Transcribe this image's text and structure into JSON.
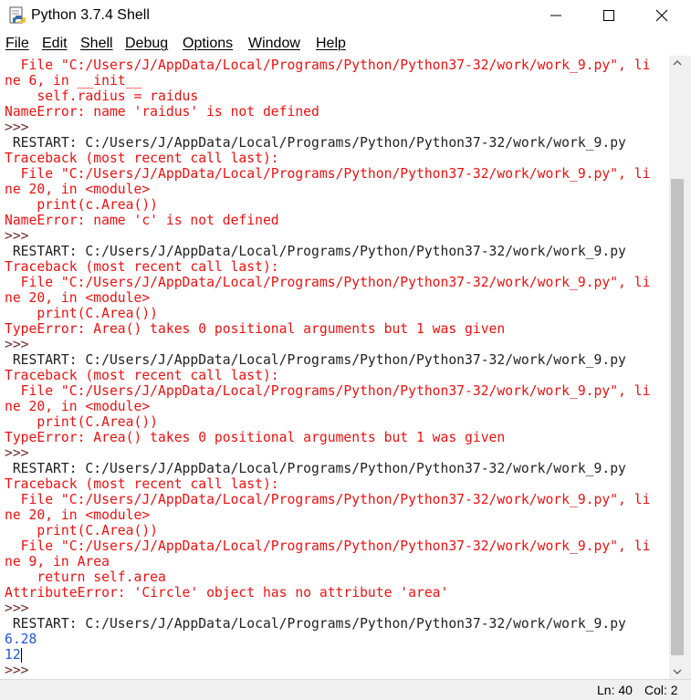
{
  "window": {
    "title": "Python 3.7.4 Shell",
    "icon": "python-idle-icon",
    "controls": {
      "minimize_icon": "minimize-icon",
      "maximize_icon": "maximize-icon",
      "close_icon": "close-icon"
    }
  },
  "menu": {
    "items": [
      "File",
      "Edit",
      "Shell",
      "Debug",
      "Options",
      "Window",
      "Help"
    ]
  },
  "shell": {
    "lines": [
      {
        "text": "  File \"C:/Users/J/AppData/Local/Programs/Python/Python37-32/work/work_9.py\", li",
        "style": "red"
      },
      {
        "text": "ne 6, in __init__",
        "style": "red"
      },
      {
        "text": "    self.radius = raidus",
        "style": "red"
      },
      {
        "text": "NameError: name 'raidus' is not defined",
        "style": "red"
      },
      {
        "text": ">>>",
        "style": "brown"
      },
      {
        "text": " RESTART: C:/Users/J/AppData/Local/Programs/Python/Python37-32/work/work_9.py",
        "style": "dark"
      },
      {
        "text": "Traceback (most recent call last):",
        "style": "red"
      },
      {
        "text": "  File \"C:/Users/J/AppData/Local/Programs/Python/Python37-32/work/work_9.py\", li",
        "style": "red"
      },
      {
        "text": "ne 20, in <module>",
        "style": "red"
      },
      {
        "text": "    print(c.Area())",
        "style": "red"
      },
      {
        "text": "NameError: name 'c' is not defined",
        "style": "red"
      },
      {
        "text": ">>>",
        "style": "brown"
      },
      {
        "text": " RESTART: C:/Users/J/AppData/Local/Programs/Python/Python37-32/work/work_9.py",
        "style": "dark"
      },
      {
        "text": "Traceback (most recent call last):",
        "style": "red"
      },
      {
        "text": "  File \"C:/Users/J/AppData/Local/Programs/Python/Python37-32/work/work_9.py\", li",
        "style": "red"
      },
      {
        "text": "ne 20, in <module>",
        "style": "red"
      },
      {
        "text": "    print(C.Area())",
        "style": "red"
      },
      {
        "text": "TypeError: Area() takes 0 positional arguments but 1 was given",
        "style": "red"
      },
      {
        "text": ">>>",
        "style": "brown"
      },
      {
        "text": " RESTART: C:/Users/J/AppData/Local/Programs/Python/Python37-32/work/work_9.py",
        "style": "dark"
      },
      {
        "text": "Traceback (most recent call last):",
        "style": "red"
      },
      {
        "text": "  File \"C:/Users/J/AppData/Local/Programs/Python/Python37-32/work/work_9.py\", li",
        "style": "red"
      },
      {
        "text": "ne 20, in <module>",
        "style": "red"
      },
      {
        "text": "    print(C.Area())",
        "style": "red"
      },
      {
        "text": "TypeError: Area() takes 0 positional arguments but 1 was given",
        "style": "red"
      },
      {
        "text": ">>>",
        "style": "brown"
      },
      {
        "text": " RESTART: C:/Users/J/AppData/Local/Programs/Python/Python37-32/work/work_9.py",
        "style": "dark"
      },
      {
        "text": "Traceback (most recent call last):",
        "style": "red"
      },
      {
        "text": "  File \"C:/Users/J/AppData/Local/Programs/Python/Python37-32/work/work_9.py\", li",
        "style": "red"
      },
      {
        "text": "ne 20, in <module>",
        "style": "red"
      },
      {
        "text": "    print(C.Area())",
        "style": "red"
      },
      {
        "text": "  File \"C:/Users/J/AppData/Local/Programs/Python/Python37-32/work/work_9.py\", li",
        "style": "red"
      },
      {
        "text": "ne 9, in Area",
        "style": "red"
      },
      {
        "text": "    return self.area",
        "style": "red"
      },
      {
        "text": "AttributeError: 'Circle' object has no attribute 'area'",
        "style": "red"
      },
      {
        "text": ">>>",
        "style": "brown"
      },
      {
        "text": " RESTART: C:/Users/J/AppData/Local/Programs/Python/Python37-32/work/work_9.py",
        "style": "dark"
      },
      {
        "text": "6.28",
        "style": "blue"
      },
      {
        "text": "12",
        "style": "blue"
      },
      {
        "text": ">>>",
        "style": "brown"
      }
    ]
  },
  "colors": {
    "error": "#ee1111",
    "stdout": "#2255dd",
    "restart": "#222222",
    "prompt": "#6f2d2d"
  },
  "status": {
    "ln": "Ln: 40",
    "col": "Col: 2"
  }
}
